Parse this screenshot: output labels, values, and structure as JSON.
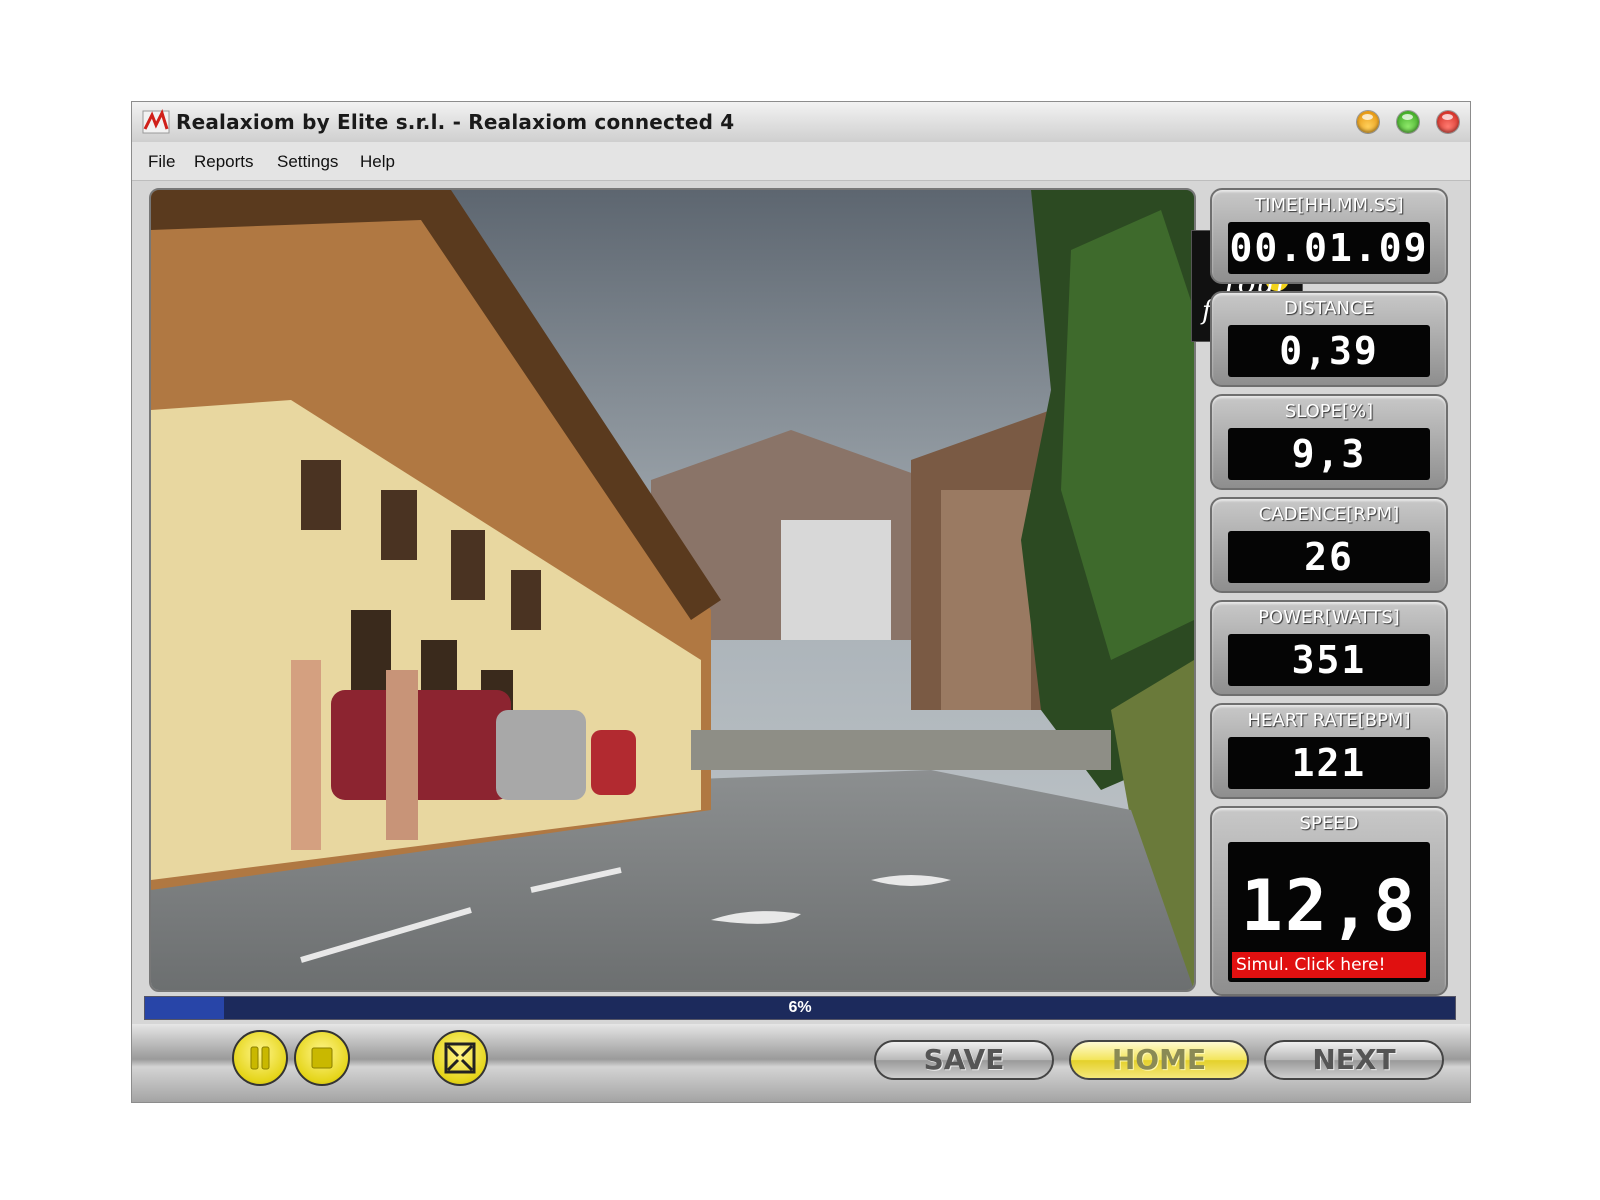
{
  "window": {
    "title": "Realaxiom by Elite s.r.l. - Realaxiom connected 4"
  },
  "menu": [
    "File",
    "Reports",
    "Settings",
    "Help"
  ],
  "overlay_logo": {
    "icon": "le-tour-de-france-logo"
  },
  "metrics": [
    {
      "label": "TIME[HH.MM.SS]",
      "value": "00.01.09"
    },
    {
      "label": "DISTANCE",
      "value": "0,39"
    },
    {
      "label": "SLOPE[%]",
      "value": "9,3"
    },
    {
      "label": "CADENCE[RPM]",
      "value": "26"
    },
    {
      "label": "POWER[WATTS]",
      "value": "351"
    },
    {
      "label": "HEART RATE[BPM]",
      "value": "121"
    }
  ],
  "speed": {
    "label": "SPEED",
    "value": "12,8",
    "simul_text": "Simul. Click here!"
  },
  "progress": {
    "label": "6%",
    "fraction": 0.06
  },
  "controls": {
    "pause_icon": "pause-icon",
    "stop_icon": "stop-icon",
    "fullscreen_icon": "fullscreen-icon",
    "save_label": "SAVE",
    "home_label": "HOME",
    "next_label": "NEXT"
  },
  "colors": {
    "accent_yellow": "#f3e55a",
    "progress_bg": "#1c2a5c",
    "progress_fill": "#2845a8",
    "simul_red": "#e01010"
  }
}
